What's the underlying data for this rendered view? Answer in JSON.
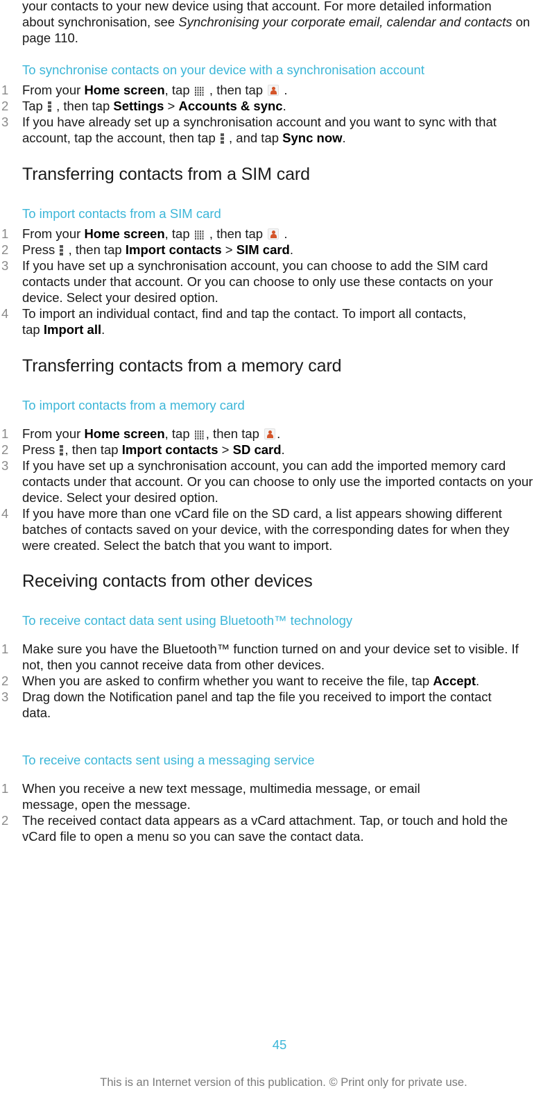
{
  "intro": {
    "line1": "your contacts to your new device using that account. For more detailed information",
    "line2_prefix": "about synchronisation, see ",
    "link_text": "Synchronising your corporate email, calendar and contacts",
    "line_suffix": " on page 110."
  },
  "sections": {
    "sync_task": {
      "title": "To synchronise contacts on your device with a synchronisation account",
      "steps": [
        {
          "num": "1",
          "t1": "From your ",
          "b1": "Home screen",
          "t2": ", tap ",
          "t3": " , then tap ",
          "t4": " ."
        },
        {
          "num": "2",
          "t1": "Tap ",
          "t2": " , then tap ",
          "b1": "Settings",
          "t3": " > ",
          "b2": "Accounts & sync",
          "t4": "."
        },
        {
          "num": "3",
          "t1": "If you have already set up a synchronisation account and you want to sync with that account, tap the account, then tap ",
          "t2": " , and tap ",
          "b1": "Sync now",
          "t3": "."
        }
      ]
    },
    "sim": {
      "heading": "Transferring contacts from a SIM card",
      "task_title": "To import contacts from a SIM card",
      "steps": [
        {
          "num": "1",
          "t1": "From your ",
          "b1": "Home screen",
          "t2": ", tap ",
          "t3": " , then tap ",
          "t4": " ."
        },
        {
          "num": "2",
          "t1": "Press ",
          "t2": " , then tap ",
          "b1": "Import contacts",
          "t3": " > ",
          "b2": "SIM card",
          "t4": "."
        },
        {
          "num": "3",
          "t1": "If you have set up a synchronisation account, you can choose to add the SIM card contacts under that account. Or you can choose to only use these contacts on your device. Select your desired option."
        },
        {
          "num": "4",
          "t1": "To import an individual contact, find and tap the contact. To import all contacts, tap ",
          "b1": "Import all",
          "t2": "."
        }
      ]
    },
    "memory": {
      "heading": "Transferring contacts from a memory card",
      "task_title": "To import contacts from a memory card",
      "steps": [
        {
          "num": "1",
          "t1": "From your ",
          "b1": "Home screen",
          "t2": ", tap ",
          "t3": ", then tap ",
          "t4": "."
        },
        {
          "num": "2",
          "t1": "Press ",
          "t2": ", then tap ",
          "b1": "Import contacts",
          "t3": " > ",
          "b2": "SD card",
          "t4": "."
        },
        {
          "num": "3",
          "t1": "If you have set up a synchronisation account, you can add the imported memory card contacts under that account. Or you can choose to only use the imported contacts on your device. Select your desired option."
        },
        {
          "num": "4",
          "t1": "If you have more than one vCard file on the SD card, a list appears showing different batches of contacts saved on your device, with the corresponding dates for when they were created. Select the batch that you want to import."
        }
      ]
    },
    "receiving": {
      "heading": "Receiving contacts from other devices",
      "bt_task_title": "To receive contact data sent using Bluetooth™ technology",
      "bt_steps": [
        {
          "num": "1",
          "t1": "Make sure you have the Bluetooth™ function turned on and your device set to visible. If not, then you cannot receive data from other devices."
        },
        {
          "num": "2",
          "t1": "When you are asked to confirm whether you want to receive the file, tap ",
          "b1": "Accept",
          "t2": "."
        },
        {
          "num": "3",
          "t1": "Drag down the Notification panel and tap the file you received to import the contact data."
        }
      ],
      "msg_task_title": "To receive contacts sent using a messaging service",
      "msg_steps": [
        {
          "num": "1",
          "t1": "When you receive a new text message, multimedia message, or email message, open the message."
        },
        {
          "num": "2",
          "t1": "The received contact data appears as a vCard attachment. Tap, or touch and hold the vCard file to open a menu so you can save the contact data."
        }
      ]
    }
  },
  "footer": {
    "page_number": "45",
    "note": "This is an Internet version of this publication. © Print only for private use."
  },
  "icons": {
    "apps": "apps-grid-icon",
    "contacts": "contacts-app-icon",
    "menu": "menu-icon"
  },
  "colors": {
    "body_text": "#1a1a1a",
    "task_heading": "#3cb6d8",
    "step_number": "#8a8a8a",
    "footer_note": "#7a7a7a"
  }
}
